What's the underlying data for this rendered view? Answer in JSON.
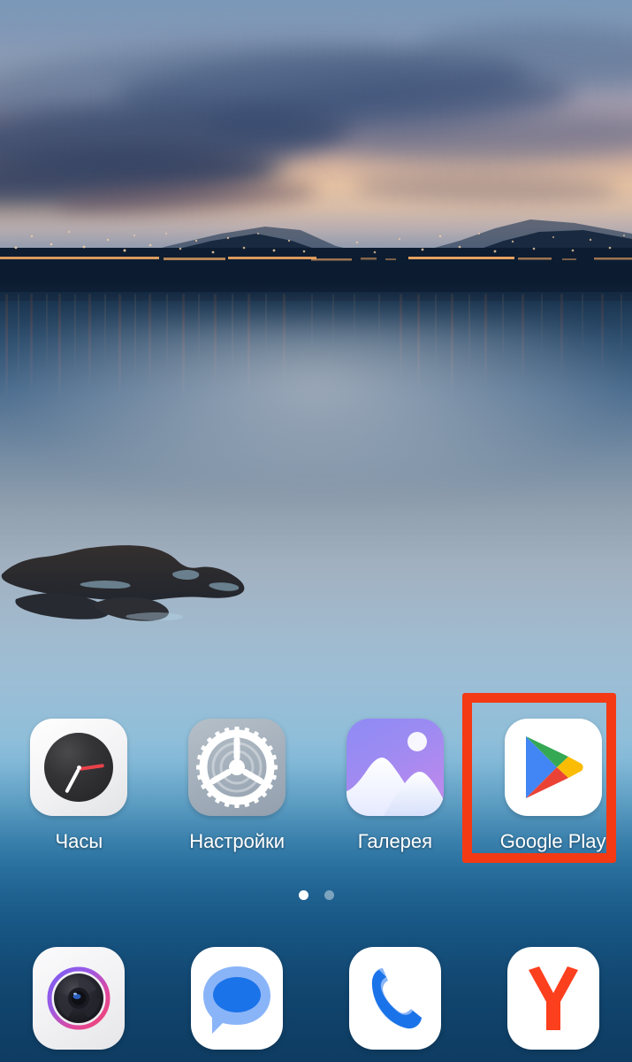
{
  "screen": {
    "device_type": "android-home-screen",
    "wallpaper_description": "Sunset lake with mountain silhouettes, city lights and reflections"
  },
  "colors": {
    "highlight_box": "#f43a14",
    "label_text": "#ffffff",
    "page_dot_active": "#ffffff",
    "page_dot_inactive": "rgba(255,255,255,0.42)",
    "play_green": "#34a853",
    "play_blue": "#4285f4",
    "play_yellow": "#fbbc04",
    "play_red": "#ea4335",
    "yandex_red": "#fc3f1d",
    "phone_blue": "#1a73e8",
    "messages_blue": "#1a73e8"
  },
  "apps": [
    {
      "id": "clock",
      "label": "Часы",
      "icon": "clock-icon",
      "highlighted": false
    },
    {
      "id": "settings",
      "label": "Настройки",
      "icon": "settings-gear-icon",
      "highlighted": false
    },
    {
      "id": "gallery",
      "label": "Галерея",
      "icon": "gallery-photo-icon",
      "highlighted": false
    },
    {
      "id": "play",
      "label": "Google Play",
      "icon": "google-play-icon",
      "highlighted": true
    }
  ],
  "page_indicator": {
    "total": 2,
    "active_index": 0,
    "dots": [
      {
        "state": "active"
      },
      {
        "state": "inactive"
      }
    ]
  },
  "dock": {
    "items": [
      {
        "id": "camera",
        "icon": "camera-icon",
        "label": ""
      },
      {
        "id": "messages",
        "icon": "messages-bubble-icon",
        "label": ""
      },
      {
        "id": "phone",
        "icon": "phone-handset-icon",
        "label": ""
      },
      {
        "id": "yandex",
        "icon": "yandex-browser-icon",
        "label": ""
      }
    ]
  },
  "highlight": {
    "target_app": "Google Play",
    "shape": "rectangle-outline"
  }
}
